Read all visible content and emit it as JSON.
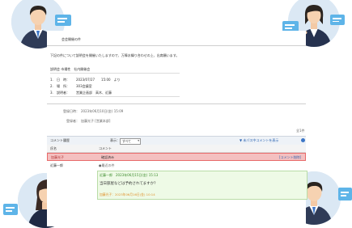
{
  "document": {
    "subject": "会会開催の件",
    "body_text": "下記の件について説明会を開催いたしますので、万障お繰り合わせの上、出席願います。",
    "detail_label": "説明会 市場性　社内開催会",
    "details": [
      {
        "num": "1.",
        "label": "日　時：",
        "value": "2023/07/27　　15:00　より"
      },
      {
        "num": "2.",
        "label": "場　所：",
        "value": "303会議室"
      },
      {
        "num": "3.",
        "label": "説明者：",
        "value": "営業企画部　高木、近藤"
      }
    ],
    "registered_label": "登録日時：",
    "registered_value": "2023年06月10日(金) 15:09",
    "registrant_label": "登録者：",
    "registrant_value": "加藤光子 [営業本部]",
    "pager": "全1件"
  },
  "comments": {
    "section_label": "コメント履歴",
    "display_label": "表示：",
    "display_select": "すべて",
    "filter_label": "▼ 未パス中コメントを表示",
    "delete_label": "[コメントを全削除]",
    "col_name": "氏名",
    "col_comment": "コメント",
    "row1_name": "加藤光子",
    "row1_comment": "確認済み",
    "row1_link": "[コメント削除]",
    "row2_name": "近藤一郎",
    "row2_header": "●最近の件",
    "row2_meta": "近藤一郎　2023年06月15日(金) 15:13",
    "row2_comment": "当日部屋などは予約されてますか？",
    "row2_reply": "加藤光子：2023年06月16日(金) 10:14"
  },
  "colors": {
    "avatar_bg": "#dbe8f4",
    "bubble_blue": "#5eb4e8",
    "bubble_yellow": "#f6c85a",
    "highlight_red": "#f4a6a6",
    "green_row": "#eefae6"
  }
}
